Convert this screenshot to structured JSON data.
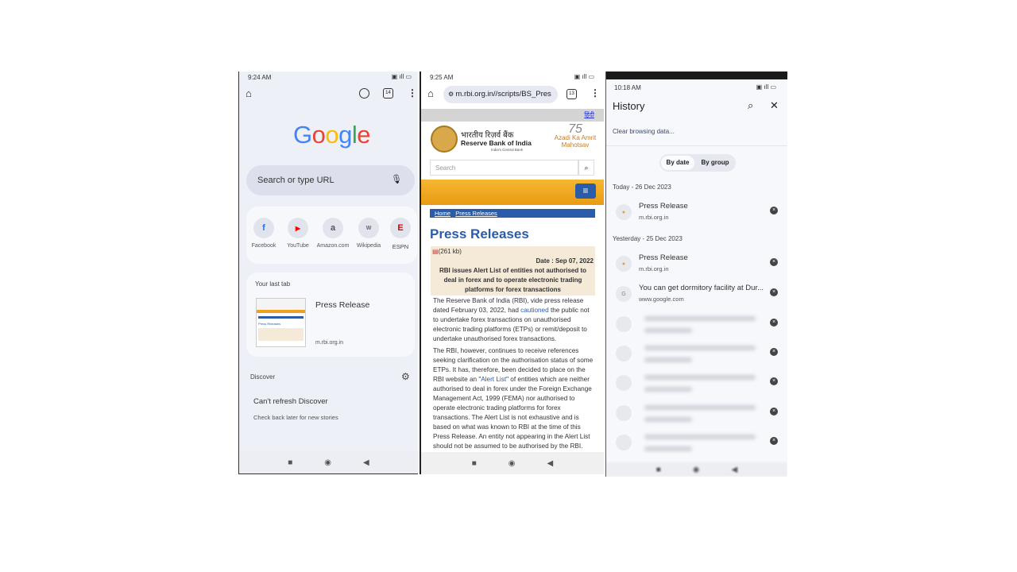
{
  "panel1": {
    "status_time": "9:24 AM",
    "tab_count": "14",
    "logo": "Google",
    "search_placeholder": "Search or type URL",
    "shortcuts": [
      {
        "label": "Facebook",
        "icon": "f",
        "color": "#1877f2"
      },
      {
        "label": "YouTube",
        "icon": "▶",
        "color": "#ff0000"
      },
      {
        "label": "Amazon.com",
        "icon": "a",
        "color": "#111111"
      },
      {
        "label": "Wikipedia",
        "icon": "W",
        "color": "#666666"
      },
      {
        "label": "ESPN",
        "icon": "E",
        "color": "#d00000"
      }
    ],
    "last_tab_heading": "Your last tab",
    "last_tab_title": "Press Release",
    "last_tab_url": "m.rbi.org.in",
    "discover_label": "Discover",
    "discover_error": "Can't refresh Discover",
    "discover_hint": "Check back later for new stories"
  },
  "panel2": {
    "status_time": "9:25 AM",
    "url": "m.rbi.org.in//scripts/BS_Pres",
    "tab_count": "13",
    "hindi_link": "हिंदी",
    "bank_name_hindi": "भारतीय रिज़र्व बैंक",
    "bank_name": "Reserve Bank of India",
    "bank_tagline": "India's Central Bank",
    "azadi": "Azadi Ka Amrit Mahotsav",
    "search_placeholder": "Search",
    "breadcrumb": [
      "Home",
      "Press Releases"
    ],
    "page_title": "Press Releases",
    "pdf_size": "(261 kb)",
    "date": "Date : Sep 07, 2022",
    "headline": "RBI issues Alert List of entities not authorised to deal in forex and to operate electronic trading platforms for forex transactions",
    "para1_a": "The Reserve Bank of India (RBI), vide press release dated February 03, 2022, had ",
    "para1_link": "cautioned",
    "para1_b": " the public not to undertake forex transactions on unauthorised electronic trading platforms (ETPs) or remit/deposit to undertake unauthorised forex transactions.",
    "para2_a": "The RBI, however, continues to receive references seeking clarification on the authorisation status of some ETPs. It has, therefore, been decided to place on the RBI website an \"",
    "para2_link": "Alert List",
    "para2_b": "\" of entities which are neither authorised to deal in forex under the Foreign Exchange Management Act, 1999 (FEMA) nor authorised to operate electronic trading platforms for forex transactions. The Alert List is not exhaustive and is based on what was known to RBI at the time of this Press Release. An entity not appearing in the Alert List should not be assumed to be authorised by the RBI."
  },
  "panel3": {
    "status_time": "10:18 AM",
    "title": "History",
    "clear_data": "Clear browsing data...",
    "toggle": [
      "By date",
      "By group"
    ],
    "sections": [
      {
        "heading": "Today - 26 Dec 2023",
        "items": [
          {
            "title": "Press Release",
            "url": "m.rbi.org.in"
          }
        ]
      },
      {
        "heading": "Yesterday - 25 Dec 2023",
        "items": [
          {
            "title": "Press Release",
            "url": "m.rbi.org.in"
          },
          {
            "title": "You can get dormitory facility at Dur...",
            "url": "www.google.com"
          }
        ]
      }
    ]
  }
}
